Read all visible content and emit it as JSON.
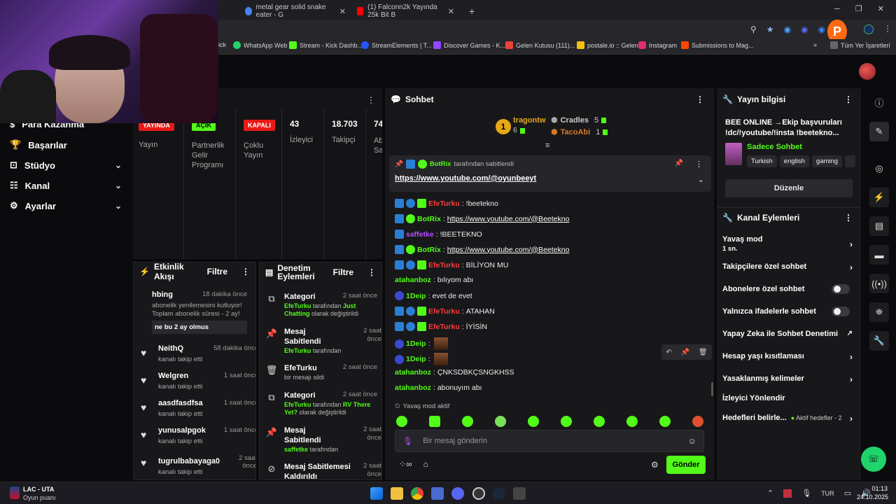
{
  "browser": {
    "tabs": [
      {
        "title": "metal gear solid snake eater - G",
        "icon_color": "#4285f4"
      },
      {
        "title": "(1) Falconn2k Yayında 25k Bit B",
        "icon_color": "#ff0000"
      }
    ],
    "new_tab": "+",
    "bookmarks": [
      {
        "label": "ick",
        "color": "#888"
      },
      {
        "label": "WhatsApp Web",
        "color": "#25d366"
      },
      {
        "label": "Stream - Kick Dashb...",
        "color": "#53fc18"
      },
      {
        "label": "StreamElements | T...",
        "color": "#2255ff"
      },
      {
        "label": "Discover Games - K...",
        "color": "#9146ff"
      },
      {
        "label": "Gelen Kutusu (111)...",
        "color": "#ea4335"
      },
      {
        "label": "postale.io :: Gelen",
        "color": "#f4c20d"
      },
      {
        "label": "Instagram",
        "color": "#e1306c"
      },
      {
        "label": "Submissions to Mag...",
        "color": "#ff4500"
      }
    ],
    "all_bookmarks": "Tüm Yer İşaretleri"
  },
  "sidebar": {
    "items": [
      {
        "label": "Para Kazanma",
        "icon": "money-icon",
        "chevron": false
      },
      {
        "label": "Başarılar",
        "icon": "trophy-icon",
        "chevron": false
      },
      {
        "label": "Stüdyo",
        "icon": "studio-icon",
        "chevron": true
      },
      {
        "label": "Kanal",
        "icon": "channel-icon",
        "chevron": true
      },
      {
        "label": "Ayarlar",
        "icon": "gear-icon",
        "chevron": true
      }
    ]
  },
  "stats": {
    "live_badge": "YAYINDA",
    "live_label": "Yayın",
    "partner_badge": "AÇIK",
    "partner_label": "Partnerlik Gelir Programı",
    "multi_badge": "KAPALI",
    "multi_label": "Çoklu Yayın",
    "viewers": "43",
    "viewers_label": "İzleyici",
    "followers": "18.703",
    "followers_label": "Takipçi",
    "subs": "74",
    "subs_label": "Ab Sa"
  },
  "activity": {
    "title": "Etkinlik Akışı",
    "filter": "Filtre",
    "events": [
      {
        "name": "hbing",
        "time": "18 dakika önce",
        "desc": "abonelik yenilemesini kutluyor! Toplam abonelik süresi - 2 ay!",
        "quote": "ne bu 2 ay olmus"
      },
      {
        "name": "NeithQ",
        "time": "58 dakika önce",
        "desc": "kanalı takip etti"
      },
      {
        "name": "Welgren",
        "time": "1 saat önce",
        "desc": "kanalı takip etti"
      },
      {
        "name": "aasdfasdfsa",
        "time": "1 saat önce",
        "desc": "kanalı takip etti"
      },
      {
        "name": "yunusalpgok",
        "time": "1 saat önce",
        "desc": "kanalı takip etti"
      },
      {
        "name": "tugrulbabayaga0",
        "time": "2 saat önce",
        "desc": "kanalı takip etti"
      }
    ]
  },
  "modlog": {
    "title": "Denetim Eylemleri",
    "filter": "Filtre",
    "items": [
      {
        "title": "Kategori",
        "time": "2 saat önce",
        "user": "EfeTurku",
        "mid": " tarafından ",
        "hl": "Just Chatting",
        "end": " olarak değiştirildi",
        "icon": "category-icon"
      },
      {
        "title": "Mesaj Sabitlendi",
        "time": "2 saat önce",
        "user": "EfeTurku",
        "mid": " tarafından",
        "hl": "",
        "end": "",
        "icon": "pin-icon"
      },
      {
        "title": "EfeTurku",
        "time": "2 saat önce",
        "user": "",
        "mid": "bir mesajı sildi",
        "hl": "",
        "end": "",
        "icon": "trash-icon"
      },
      {
        "title": "Kategori",
        "time": "2 saat önce",
        "user": "EfeTurku",
        "mid": " tarafından ",
        "hl": "RV There Yet?",
        "end": " olarak değiştirildi",
        "icon": "category-icon"
      },
      {
        "title": "Mesaj Sabitlendi",
        "time": "2 saat önce",
        "user": "saffetke",
        "mid": " tarafından",
        "hl": "",
        "end": "",
        "icon": "pin-icon"
      },
      {
        "title": "Mesaj Sabitlemesi Kaldırıldı",
        "time": "2 saat önce",
        "user": "",
        "mid": "",
        "hl": "",
        "end": "",
        "icon": "unpin-icon"
      }
    ]
  },
  "chat": {
    "title": "Sohbet",
    "leaderboard": [
      {
        "rank": "1",
        "name": "tragontw",
        "count": "6"
      },
      {
        "name": "Cradles",
        "count": "5"
      },
      {
        "name": "TacoAbi",
        "count": "1"
      }
    ],
    "pinned": {
      "by_user": "BotRix",
      "by_text": "tarafından sabitlendi",
      "link": "https://www.youtube.com/@oyunbeeyt"
    },
    "messages": [
      {
        "user": "EfeTurku",
        "color": "#ff3b3b",
        "badges": 3,
        "text": "!beetekno",
        "link": false
      },
      {
        "user": "BotRix",
        "color": "#53fc18",
        "badges": 2,
        "text": "https://www.youtube.com/@Beetekno",
        "link": true
      },
      {
        "user": "saffetke",
        "color": "#b44dff",
        "badges": 1,
        "text": "!BEETEKNO",
        "link": false
      },
      {
        "user": "BotRix",
        "color": "#53fc18",
        "badges": 2,
        "text": "https://www.youtube.com/@Beetekno",
        "link": true
      },
      {
        "user": "EfeTurku",
        "color": "#ff3b3b",
        "badges": 3,
        "text": "BİLİYON MU",
        "link": false
      },
      {
        "user": "atahanboz",
        "color": "#53fc18",
        "badges": 0,
        "text": "bılıyom abı",
        "link": false
      },
      {
        "user": "1Deip",
        "color": "#53fc18",
        "badges": 1,
        "text": "evet de evet",
        "link": false
      },
      {
        "user": "EfeTurku",
        "color": "#ff3b3b",
        "badges": 3,
        "text": "ATAHAN",
        "link": false
      },
      {
        "user": "EfeTurku",
        "color": "#ff3b3b",
        "badges": 3,
        "text": "İYİSİN",
        "link": false
      },
      {
        "user": "1Deip",
        "color": "#53fc18",
        "badges": 1,
        "text": "",
        "link": false,
        "emote": true
      },
      {
        "user": "1Deip",
        "color": "#53fc18",
        "badges": 1,
        "text": "",
        "link": false,
        "emote": true
      },
      {
        "user": "atahanboz",
        "color": "#53fc18",
        "badges": 0,
        "text": "ÇNKSDBKÇSNGKHSS",
        "link": false
      },
      {
        "user": "atahanboz",
        "color": "#53fc18",
        "badges": 0,
        "text": "abonuyım abı",
        "link": false
      }
    ],
    "slow_mode": "Yavaş mod aktif",
    "input_placeholder": "Bir mesaj gönderin",
    "send": "Gönder"
  },
  "info": {
    "title": "Yayın bilgisi",
    "stream_title": "BEE ONLINE →Ekip başvuruları !dc/!youtube/!insta !beetekno...",
    "category": "Sadece Sohbet",
    "tags": [
      "Turkish",
      "english",
      "gaming"
    ],
    "edit": "Düzenle"
  },
  "channel_actions": {
    "title": "Kanal Eylemleri",
    "slow_mode": "Yavaş mod",
    "slow_mode_value": "1 sn.",
    "followers_only": "Takipçilere özel sohbet",
    "subs_only": "Abonelere özel sohbet",
    "emote_only": "Yalnızca ifadelerle sohbet",
    "ai_mod": "Yapay Zeka ile Sohbet Denetimi",
    "age_restrict": "Hesap yaşı kısıtlaması",
    "banned_words": "Yasaklanmış kelimeler",
    "redirect": "İzleyici Yönlendir",
    "goals": "Hedefleri belirle...",
    "goals_status": "Aktif hedefler - 2"
  },
  "taskbar": {
    "game": "LAC - UTA",
    "game_sub": "Oyun puanı",
    "lang": "TUR",
    "time": "01:13",
    "date": "24.10.2025"
  },
  "colors": {
    "accent": "#53fc18",
    "live": "#e91916"
  }
}
